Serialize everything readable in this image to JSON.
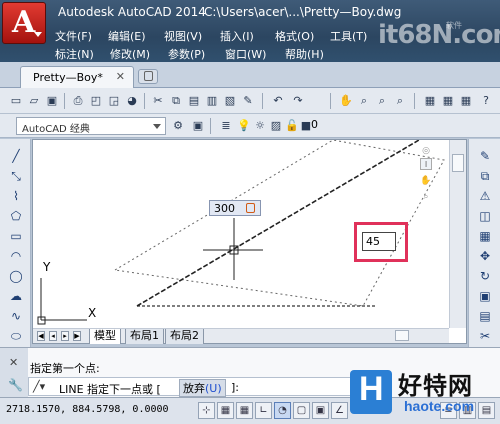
{
  "window": {
    "app_title": "Autodesk AutoCAD 2014",
    "file_path": "C:\\Users\\acer\\...\\Pretty—Boy.dwg"
  },
  "menu": {
    "row1": [
      "文件(F)",
      "编辑(E)",
      "视图(V)",
      "插入(I)",
      "格式(O)",
      "工具(T)"
    ],
    "row2": [
      "标注(N)",
      "修改(M)",
      "参数(P)",
      "窗口(W)",
      "帮助(H)"
    ]
  },
  "watermark_top": {
    "text": "it68N.com",
    "sub": "软件"
  },
  "file_tab": {
    "label": "Pretty—Boy*",
    "close": "✕"
  },
  "workspace": {
    "value": "AutoCAD 经典"
  },
  "layer": {
    "value": "0"
  },
  "canvas": {
    "axis_y": "Y",
    "axis_x": "X",
    "dynamic_distance": "300",
    "dynamic_angle": "45",
    "nav_label": "I"
  },
  "layout_tabs": [
    "模型",
    "布局1",
    "布局2"
  ],
  "command": {
    "history": "指定第一个点:",
    "prompt_text": "LINE 指定下一点或 [",
    "option_label": "放弃",
    "option_key": "(U)",
    "end": "]:"
  },
  "status": {
    "coords": "2718.1570, 884.5798, 0.0000"
  },
  "watermark_bottom": {
    "logo": "H",
    "name": "好特网",
    "url": "haote.com"
  },
  "colors": {
    "titlebar": "#2c4661",
    "app_button": "#c8201a",
    "highlight_box": "#e0315a",
    "canvas": "#ffffff"
  }
}
